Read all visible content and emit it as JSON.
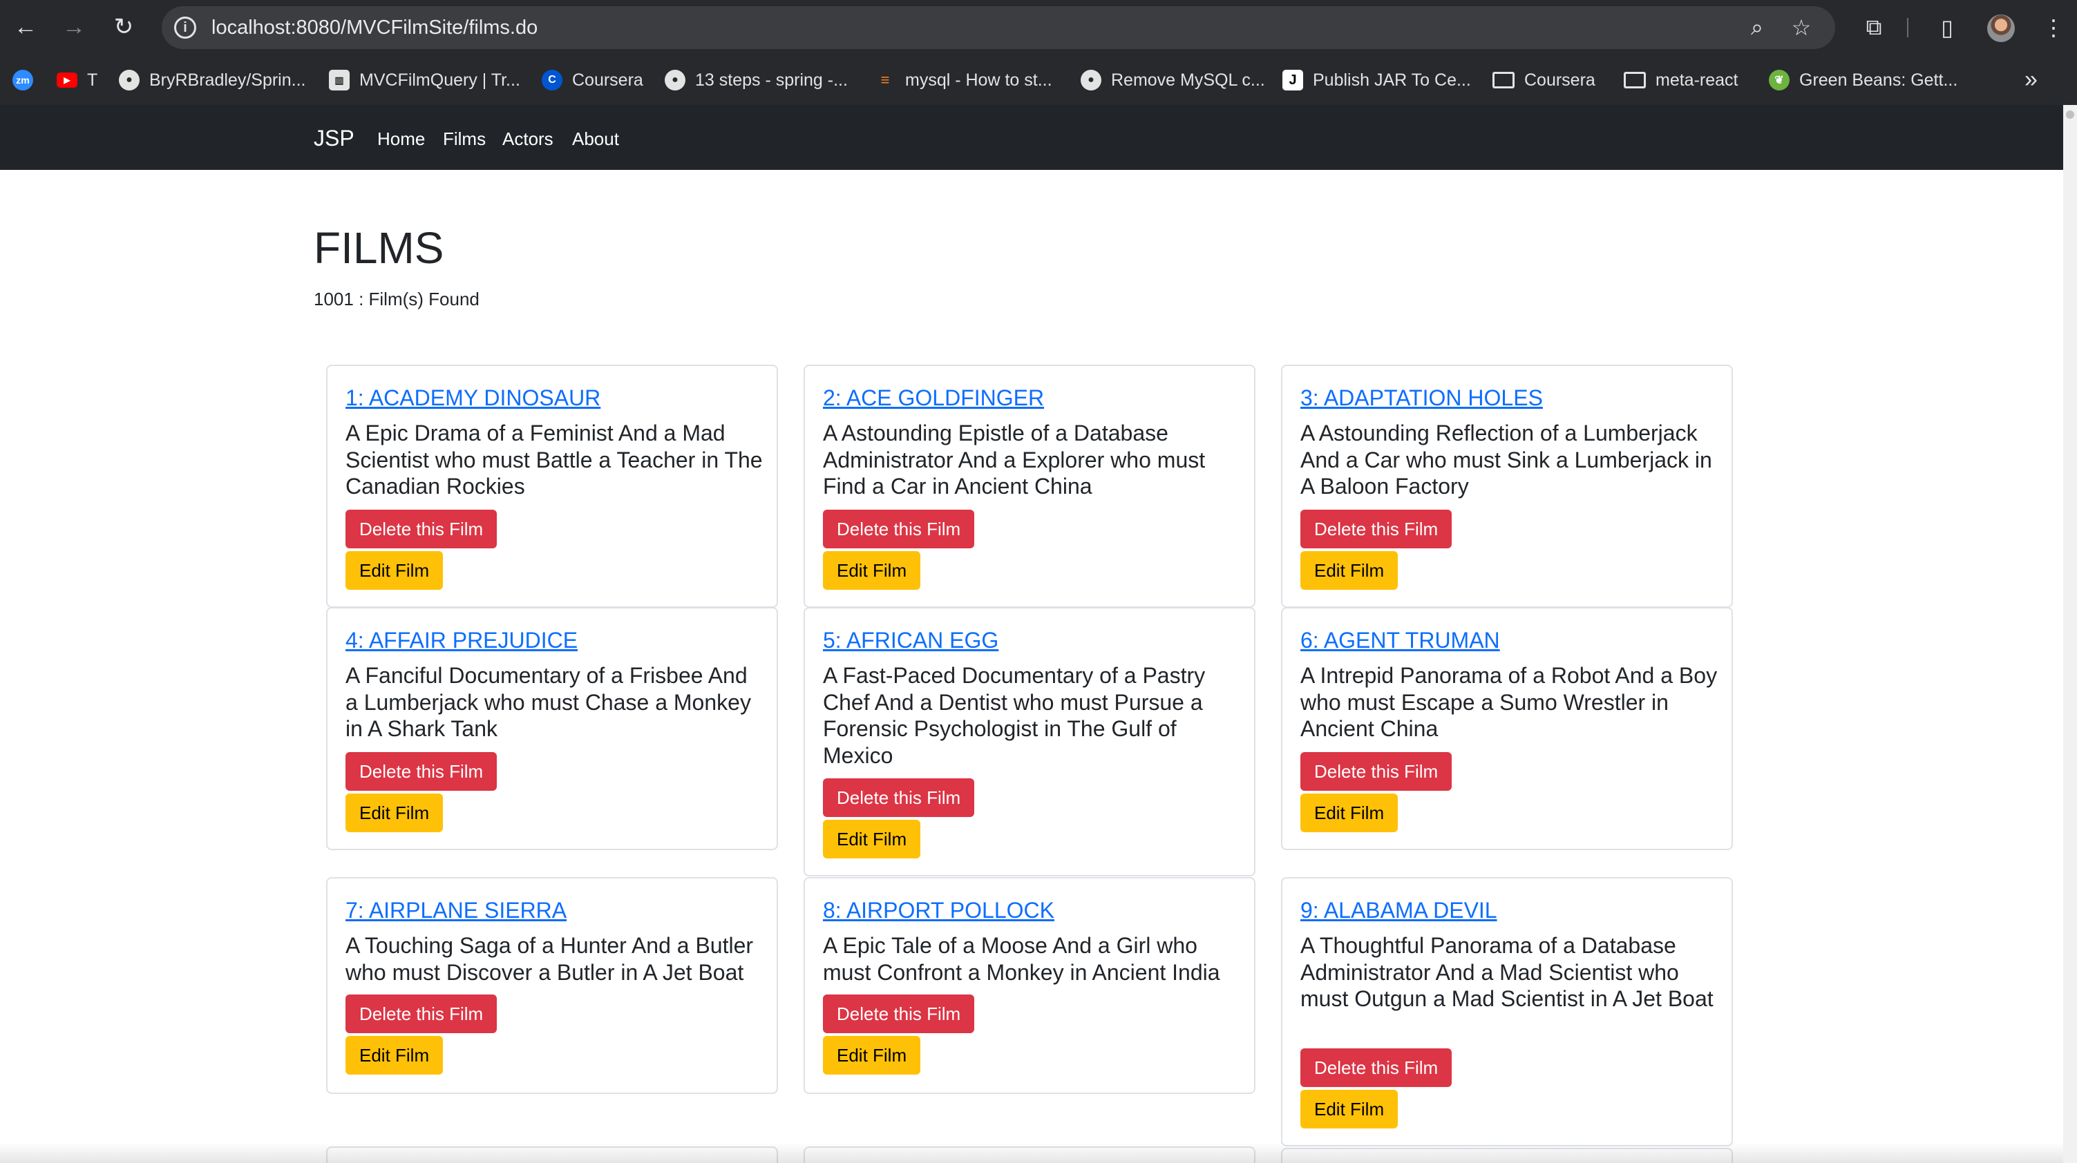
{
  "browser": {
    "url": "localhost:8080/MVCFilmSite/films.do",
    "back_icon": "←",
    "forward_icon": "→",
    "reload_icon": "↻",
    "info_icon": "i",
    "zoom_icon": "⌕",
    "star_icon": "☆",
    "extensions_icon": "⧉",
    "sidepanel_icon": "▯",
    "menu_icon": "⋮",
    "bookmarks_more_icon": "»"
  },
  "bookmarks": [
    {
      "label": "",
      "icon": "zm",
      "color": "#2d8cff"
    },
    {
      "label": "T",
      "icon": "▶",
      "color": "#ff0000"
    },
    {
      "label": "BryRBradley/Sprin...",
      "icon": "github",
      "color": "#e3e3e3"
    },
    {
      "label": "MVCFilmQuery | Tr...",
      "icon": "trello",
      "color": "#e3e3e3"
    },
    {
      "label": "Coursera",
      "icon": "C",
      "color": "#0056d2"
    },
    {
      "label": "13 steps - spring -...",
      "icon": "github",
      "color": "#e3e3e3"
    },
    {
      "label": "mysql - How to st...",
      "icon": "stackoverflow",
      "color": "#f48024"
    },
    {
      "label": "Remove MySQL c...",
      "icon": "github",
      "color": "#e3e3e3"
    },
    {
      "label": "Publish JAR To Ce...",
      "icon": "J",
      "color": "#000000"
    },
    {
      "label": "Coursera",
      "icon": "folder",
      "color": "#e3e3e3"
    },
    {
      "label": "meta-react",
      "icon": "folder",
      "color": "#e3e3e3"
    },
    {
      "label": "Green Beans: Gett...",
      "icon": "spring",
      "color": "#6db33f"
    }
  ],
  "navbar": {
    "brand": "JSP",
    "links": [
      "Home",
      "Films",
      "Actors",
      "About"
    ]
  },
  "page": {
    "title": "FILMS",
    "count_text": "1001 : Film(s) Found"
  },
  "buttons": {
    "delete_label": "Delete this Film",
    "edit_label": "Edit Film"
  },
  "films": [
    {
      "title": "1: ACADEMY DINOSAUR",
      "description": "A Epic Drama of a Feminist And a Mad Scientist who must Battle a Teacher in The Canadian Rockies"
    },
    {
      "title": "2: ACE GOLDFINGER",
      "description": "A Astounding Epistle of a Database Administrator And a Explorer who must Find a Car in Ancient China"
    },
    {
      "title": "3: ADAPTATION HOLES",
      "description": "A Astounding Reflection of a Lumberjack And a Car who must Sink a Lumberjack in A Baloon Factory"
    },
    {
      "title": "4: AFFAIR PREJUDICE",
      "description": "A Fanciful Documentary of a Frisbee And a Lumberjack who must Chase a Monkey in A Shark Tank"
    },
    {
      "title": "5: AFRICAN EGG",
      "description": "A Fast-Paced Documentary of a Pastry Chef And a Dentist who must Pursue a Forensic Psychologist in The Gulf of Mexico"
    },
    {
      "title": "6: AGENT TRUMAN",
      "description": "A Intrepid Panorama of a Robot And a Boy who must Escape a Sumo Wrestler in Ancient China"
    },
    {
      "title": "7: AIRPLANE SIERRA",
      "description": "A Touching Saga of a Hunter And a Butler who must Discover a Butler in A Jet Boat"
    },
    {
      "title": "8: AIRPORT POLLOCK",
      "description": "A Epic Tale of a Moose And a Girl who must Confront a Monkey in Ancient India"
    },
    {
      "title": "9: ALABAMA DEVIL",
      "description": "A Thoughtful Panorama of a Database Administrator And a Mad Scientist who must Outgun a Mad Scientist in A Jet Boat"
    }
  ],
  "colors": {
    "chrome": "#28292c",
    "navbar": "#212529",
    "link": "#0d6efd",
    "danger": "#dc3545",
    "warning": "#ffc107"
  }
}
